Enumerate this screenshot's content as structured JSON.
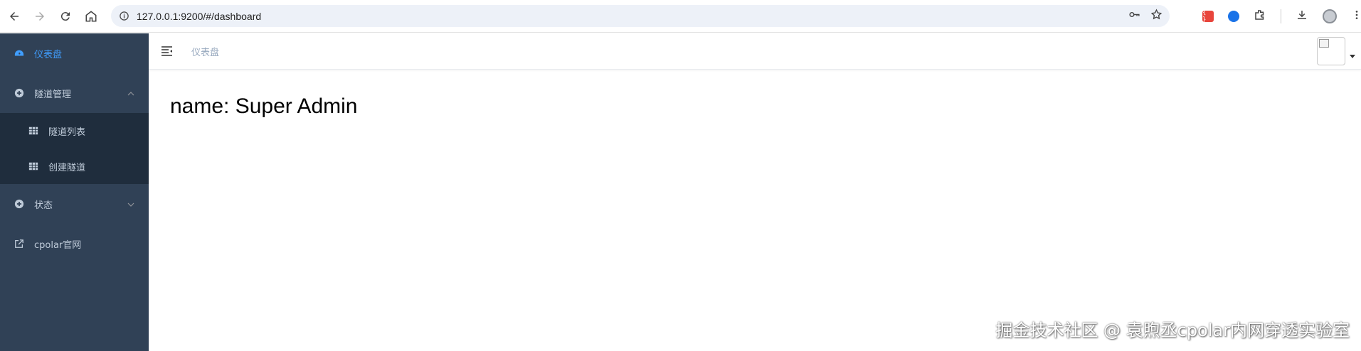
{
  "browser": {
    "url": "127.0.0.1:9200/#/dashboard"
  },
  "sidebar": {
    "items": [
      {
        "label": "仪表盘",
        "icon": "dashboard-icon",
        "active": true
      },
      {
        "label": "隧道管理",
        "icon": "plus-circle-icon",
        "expanded": true,
        "children": [
          {
            "label": "隧道列表",
            "icon": "table-icon"
          },
          {
            "label": "创建隧道",
            "icon": "table-icon"
          }
        ]
      },
      {
        "label": "状态",
        "icon": "plus-circle-icon",
        "expanded": false
      },
      {
        "label": "cpolar官网",
        "icon": "external-link-icon"
      }
    ]
  },
  "navbar": {
    "breadcrumb": "仪表盘"
  },
  "dashboard": {
    "text": "name: Super Admin"
  },
  "watermark": "掘金技术社区 @ 袁煦丞cpolar内网穿透实验室",
  "colors": {
    "sidebar_bg": "#304156",
    "submenu_bg": "#1f2d3d",
    "active": "#409eff",
    "menu_text": "#bfcbd9"
  }
}
